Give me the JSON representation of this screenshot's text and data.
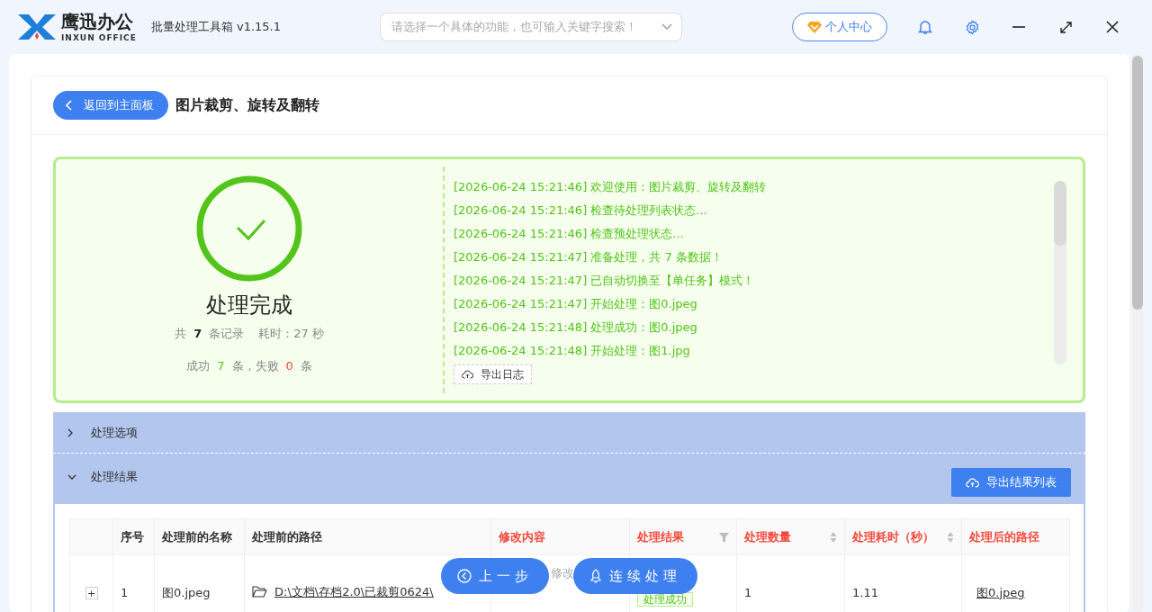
{
  "app": {
    "logo_cn": "鹰迅办公",
    "logo_en": "INXUN OFFICE",
    "title": "批量处理工具箱 v1.15.1"
  },
  "search": {
    "placeholder": "请选择一个具体的功能，也可输入关键字搜索！"
  },
  "user_button": "个人中心",
  "back_button": "返回到主面板",
  "page_title": "图片裁剪、旋转及翻转",
  "status": {
    "title": "处理完成",
    "done": true,
    "summary": {
      "prefix": "共",
      "total": "7",
      "suffix": "条记录",
      "elapsed": "耗时：27 秒"
    },
    "results": {
      "success_label": "成功",
      "success": "7",
      "middle": "条，失败",
      "failed": "0",
      "suffix": "条"
    }
  },
  "log": [
    "[2026-06-24 15:21:46] 欢迎使用：图片裁剪、旋转及翻转",
    "[2026-06-24 15:21:46] 检查待处理列表状态...",
    "[2026-06-24 15:21:46] 检查预处理状态...",
    "[2026-06-24 15:21:47] 准备处理，共 7 条数据！",
    "[2026-06-24 15:21:47] 已自动切换至【单任务】模式！",
    "[2026-06-24 15:21:47] 开始处理：图0.jpeg",
    "[2026-06-24 15:21:48] 处理成功：图0.jpeg",
    "[2026-06-24 15:21:48] 开始处理：图1.jpg"
  ],
  "export_log_button": "导出日志",
  "sections": [
    {
      "title": "处理选项",
      "expanded": false
    },
    {
      "title": "处理结果",
      "expanded": true
    }
  ],
  "export_results_button": "导出结果列表",
  "table": {
    "columns": [
      {
        "label": "序号",
        "emphasis": false,
        "filterable": false,
        "sortable": false
      },
      {
        "label": "处理前的名称",
        "emphasis": false,
        "filterable": false,
        "sortable": false
      },
      {
        "label": "处理前的路径",
        "emphasis": false,
        "filterable": false,
        "sortable": false
      },
      {
        "label": "修改内容",
        "emphasis": true,
        "filterable": false,
        "sortable": false
      },
      {
        "label": "处理结果",
        "emphasis": true,
        "filterable": true,
        "sortable": false
      },
      {
        "label": "处理数量",
        "emphasis": true,
        "filterable": false,
        "sortable": true
      },
      {
        "label": "处理耗时（秒）",
        "emphasis": true,
        "filterable": false,
        "sortable": true
      },
      {
        "label": "处理后的路径",
        "emphasis": true,
        "filterable": false,
        "sortable": false
      }
    ],
    "rows": [
      {
        "expand": "+",
        "index": "1",
        "name": "图0.jpeg",
        "path": "D:\\文档\\存档2.0\\已裁剪0624\\",
        "change": "修改",
        "result": "处理成功",
        "count": "1",
        "time": "1.11",
        "output": "图0.jpeg"
      }
    ]
  },
  "footer_buttons": [
    {
      "label": "上一步",
      "kind": "back"
    },
    {
      "label": "连续处理",
      "kind": "continue"
    }
  ]
}
